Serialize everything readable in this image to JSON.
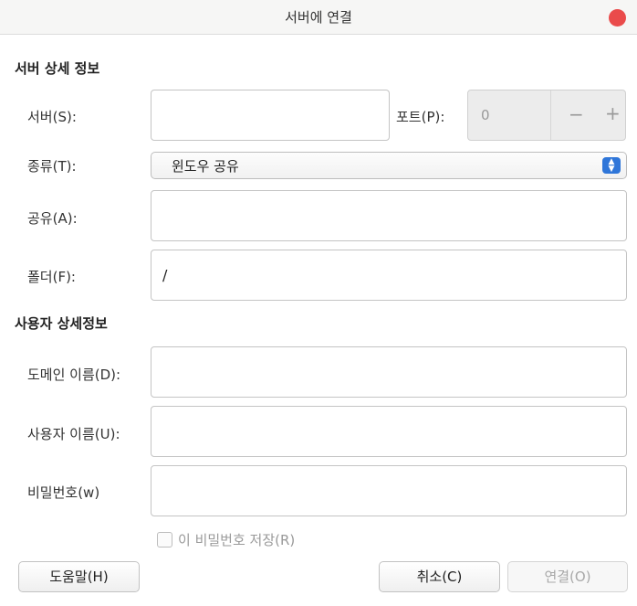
{
  "window": {
    "title": "서버에 연결"
  },
  "sections": {
    "server": "서버 상세 정보",
    "user": "사용자 상세정보"
  },
  "server": {
    "server_label": "서버(S):",
    "server_value": "",
    "port_label": "포트(P):",
    "port_value": "0",
    "port_minus": "−",
    "port_plus": "+",
    "type_label": "종류(T):",
    "type_value": "윈도우 공유",
    "share_label": "공유(A):",
    "share_value": "",
    "folder_label": "폴더(F):",
    "folder_value": "/"
  },
  "user": {
    "domain_label": "도메인 이름(D):",
    "domain_value": "",
    "username_label": "사용자 이름(U):",
    "username_value": "",
    "password_label": "비밀번호(w)",
    "password_value": "",
    "remember_label": "이 비밀번호 저장(R)",
    "remember_checked": false
  },
  "buttons": {
    "help": "도움말(H)",
    "cancel": "취소(C)",
    "connect": "연결(O)"
  },
  "colors": {
    "close": "#ea4b4b",
    "combo_accent": "#2f76d9"
  },
  "icons": {
    "close": "close-icon",
    "combo": "up-down-chevron-icon"
  }
}
